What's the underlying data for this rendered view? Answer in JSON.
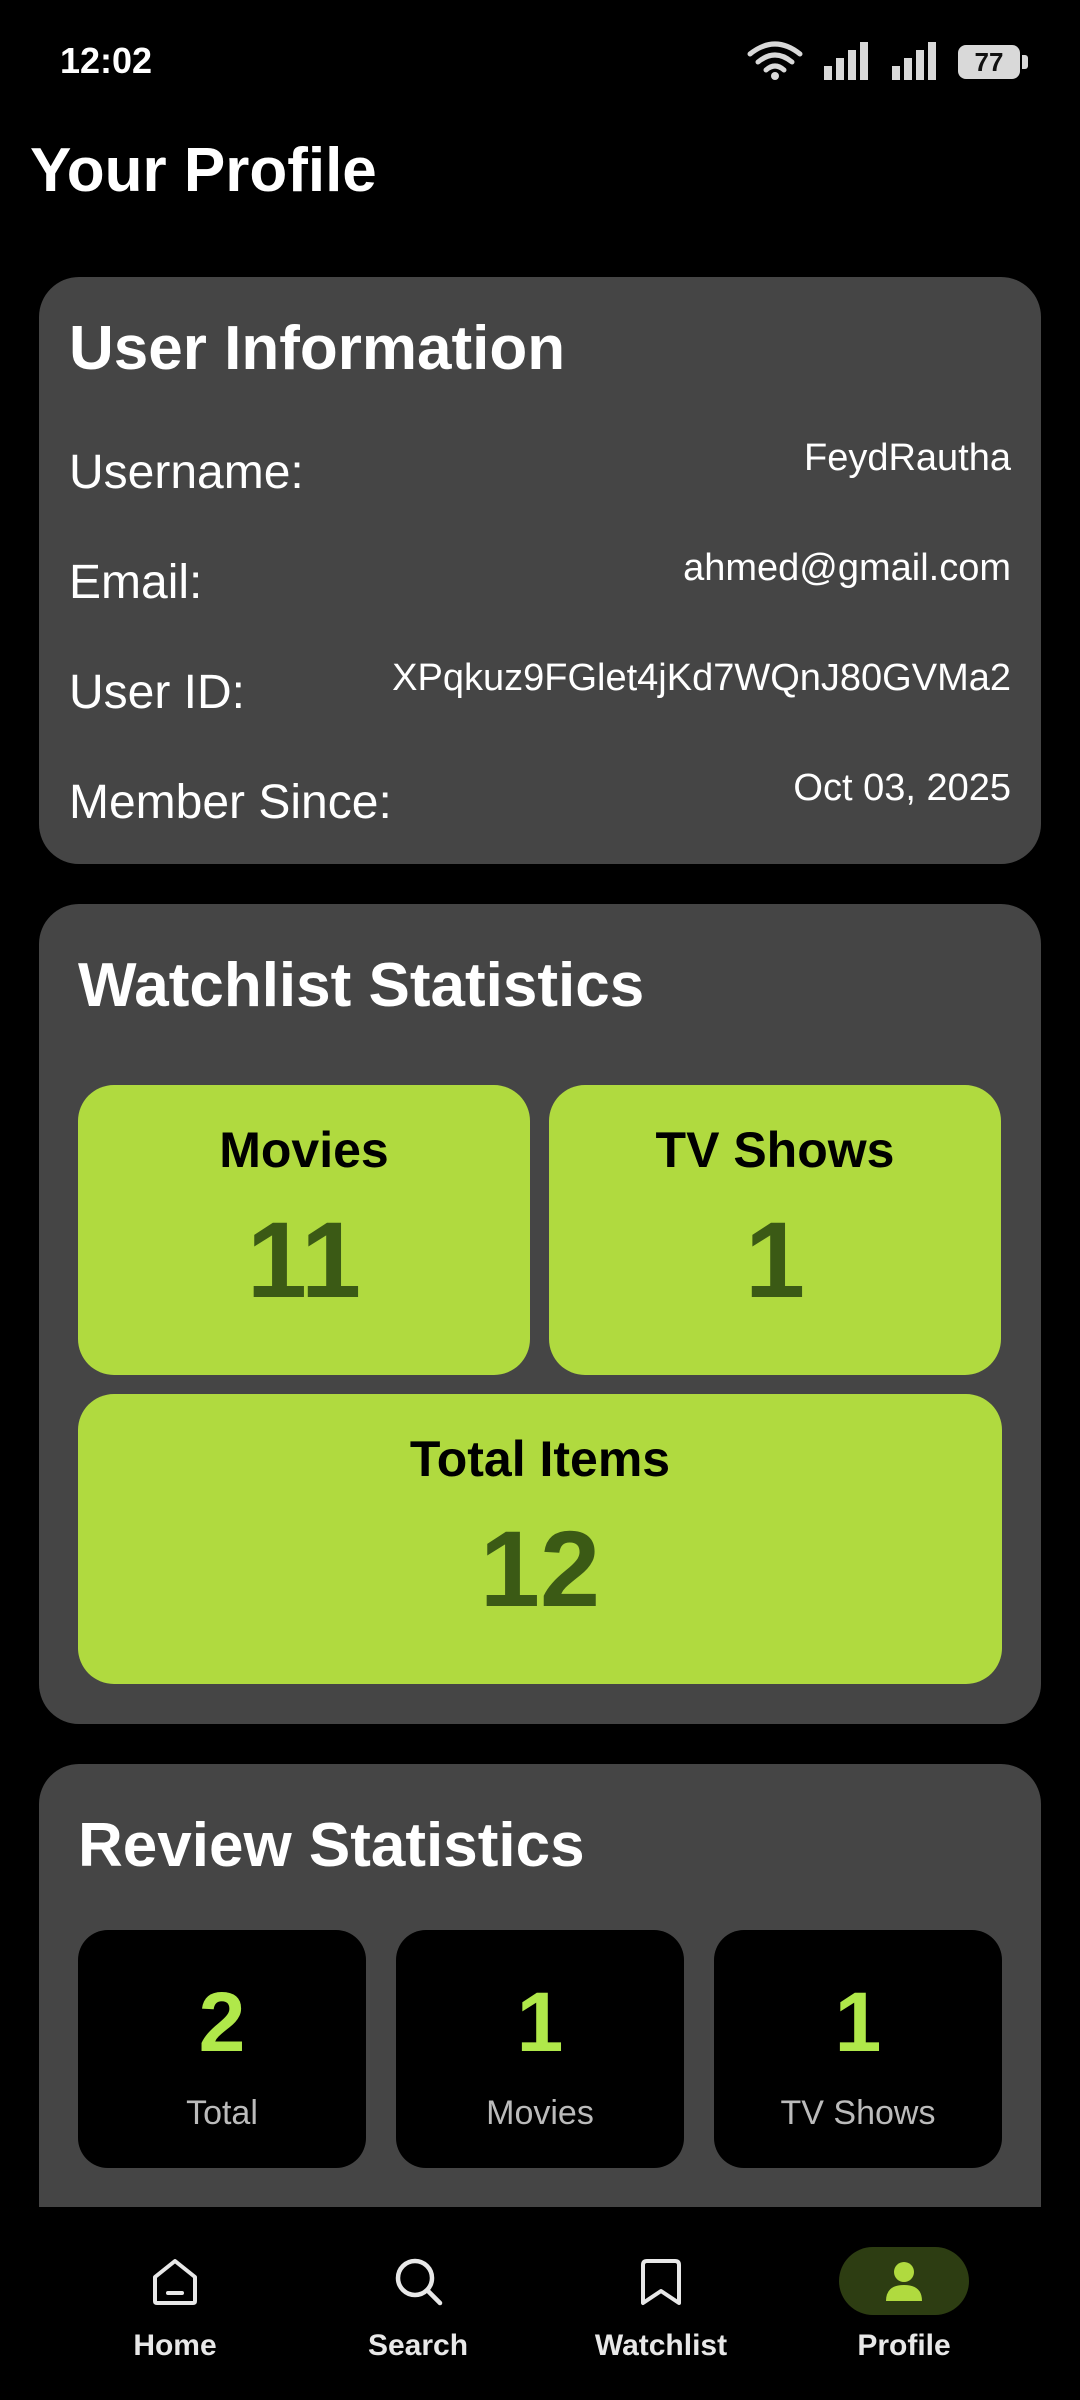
{
  "status_bar": {
    "time": "12:02",
    "battery": "77",
    "icons": [
      "wifi-icon",
      "signal-icon",
      "signal-icon",
      "battery-icon"
    ]
  },
  "page": {
    "title": "Your Profile"
  },
  "user_info": {
    "title": "User Information",
    "rows": [
      {
        "label": "Username:",
        "value": "FeydRautha"
      },
      {
        "label": "Email:",
        "value": "ahmed@gmail.com"
      },
      {
        "label": "User ID:",
        "value": "XPqkuz9FGlet4jKd7WQnJ80GVMa2"
      },
      {
        "label": "Member Since:",
        "value": "Oct 03, 2025"
      }
    ]
  },
  "watchlist_stats": {
    "title": "Watchlist Statistics",
    "movies": {
      "label": "Movies",
      "value": "11"
    },
    "tv_shows": {
      "label": "TV Shows",
      "value": "1"
    },
    "total": {
      "label": "Total Items",
      "value": "12"
    }
  },
  "review_stats": {
    "title": "Review Statistics",
    "items": [
      {
        "value": "2",
        "label": "Total"
      },
      {
        "value": "1",
        "label": "Movies"
      },
      {
        "value": "1",
        "label": "TV Shows"
      }
    ]
  },
  "bottom_nav": {
    "items": [
      {
        "label": "Home",
        "icon": "home-icon",
        "active": false
      },
      {
        "label": "Search",
        "icon": "search-icon",
        "active": false
      },
      {
        "label": "Watchlist",
        "icon": "bookmark-icon",
        "active": false
      },
      {
        "label": "Profile",
        "icon": "person-icon",
        "active": true
      }
    ]
  },
  "colors": {
    "accent": "#b0da3f",
    "card": "#454545",
    "background": "#000000",
    "tile_value": "#3b5a15"
  }
}
